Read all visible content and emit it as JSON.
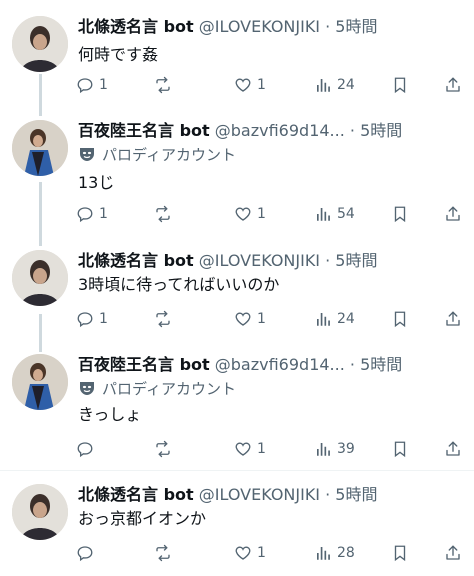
{
  "tweets": [
    {
      "name": "北條透名言 bot",
      "handle": "@ILOVEKONJIKI",
      "time": "5時間",
      "parody": "",
      "text": "何時です姦",
      "replies": "1",
      "reposts": "",
      "likes": "1",
      "views": "24"
    },
    {
      "name": "百夜陸王名言 bot",
      "handle": "@bazvfi69d14...",
      "time": "5時間",
      "parody": "パロディアカウント",
      "text": "13じ",
      "replies": "1",
      "reposts": "",
      "likes": "1",
      "views": "54"
    },
    {
      "name": "北條透名言 bot",
      "handle": "@ILOVEKONJIKI",
      "time": "5時間",
      "parody": "",
      "text": "3時頃に待ってればいいのか",
      "replies": "1",
      "reposts": "",
      "likes": "1",
      "views": "24"
    },
    {
      "name": "百夜陸王名言 bot",
      "handle": "@bazvfi69d14...",
      "time": "5時間",
      "parody": "パロディアカウント",
      "text": "きっしょ",
      "replies": "",
      "reposts": "",
      "likes": "1",
      "views": "39"
    },
    {
      "name": "北條透名言 bot",
      "handle": "@ILOVEKONJIKI",
      "time": "5時間",
      "parody": "",
      "text": "おっ京都イオンか",
      "replies": "",
      "reposts": "",
      "likes": "1",
      "views": "28"
    }
  ],
  "separator": " · ",
  "icons": [
    "reply-icon",
    "repost-icon",
    "like-icon",
    "views-icon",
    "bookmark-icon",
    "share-icon",
    "parody-mask-icon"
  ],
  "colors": {
    "text": "#0f1419",
    "secondary": "#536471",
    "thread_line": "#cfd9de",
    "divider": "#eff3f4"
  }
}
